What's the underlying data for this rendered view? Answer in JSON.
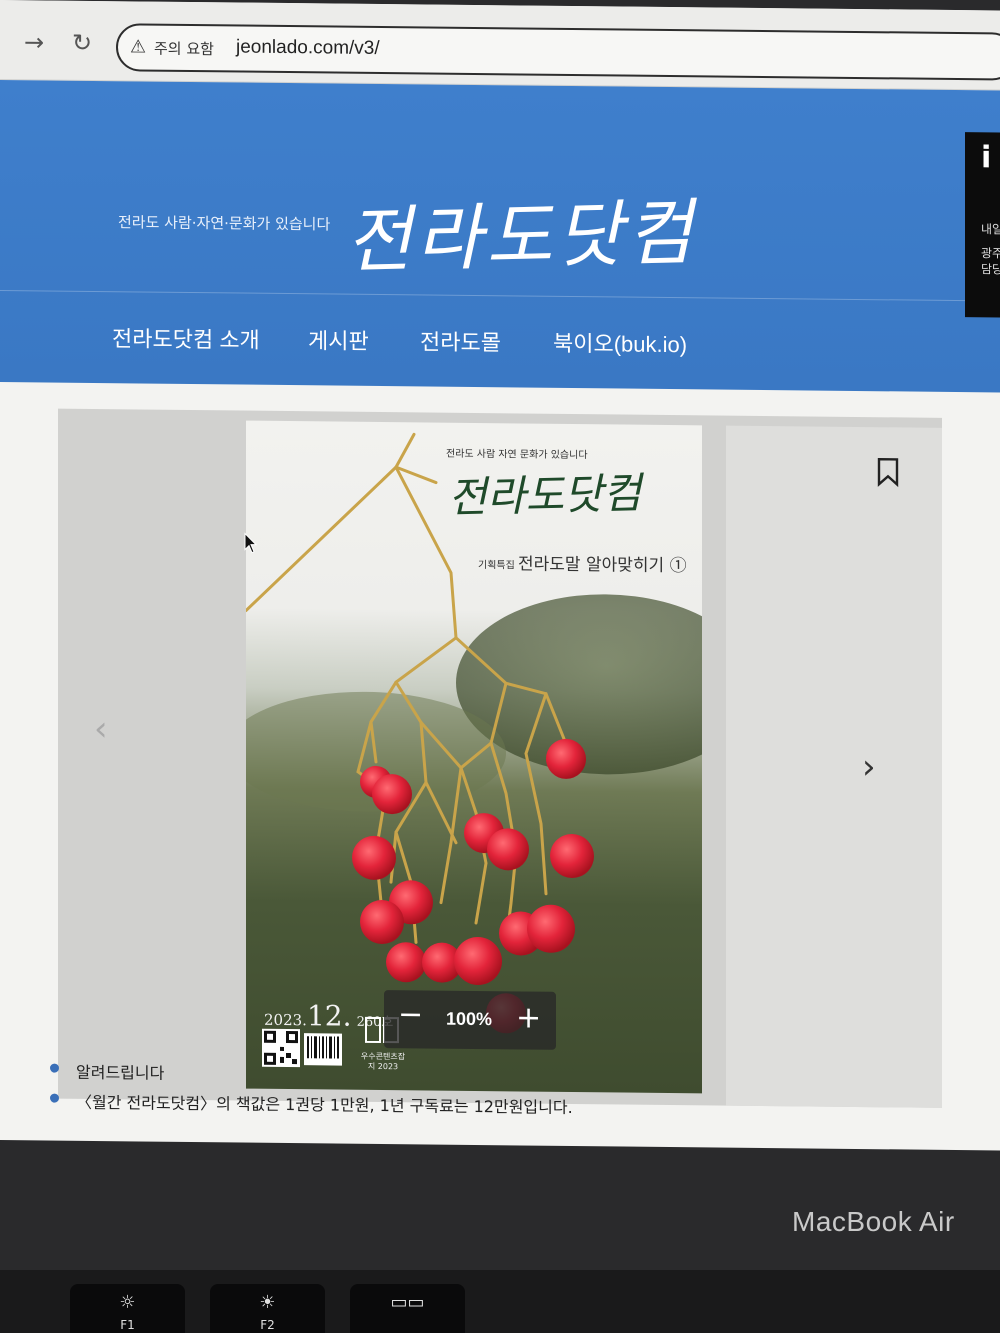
{
  "browser": {
    "warning_label": "주의 요함",
    "url": "jeonlado.com/v3/"
  },
  "header": {
    "tagline": "전라도 사람·자연·문화가 있습니다",
    "logo": "전라도닷컴",
    "nav": [
      "전라도닷컴 소개",
      "게시판",
      "전라도몰",
      "북이오(buk.io)"
    ],
    "ad_big_text": "i",
    "ad_lines": [
      "내일",
      "광주",
      "담당"
    ]
  },
  "cover": {
    "tagline": "전라도 사람 자연 문화가 있습니다",
    "logo": "전라도닷컴",
    "feature_tag": "기획특집",
    "feature_title": "전라도말 알아맞히기 ①",
    "date_year": "2023.",
    "date_month": "12.",
    "issue": "260호",
    "award": "우수콘텐츠잡지 2023"
  },
  "viewer": {
    "zoom_level": "100%",
    "zoom_out": "−",
    "zoom_in": "+"
  },
  "notices": [
    "알려드립니다",
    "〈월간 전라도닷컴〉의 책값은 1권당 1만원, 1년 구독료는 12만원입니다."
  ],
  "device": {
    "label": "MacBook Air",
    "keys": [
      {
        "icon": "☼",
        "label": "F1"
      },
      {
        "icon": "☀",
        "label": "F2"
      },
      {
        "icon": "▭▭",
        "label": ""
      }
    ]
  },
  "colors": {
    "header_blue": "#3f7fcc",
    "berry_red": "#e3243a",
    "cover_logo_green": "#1f4a2a"
  }
}
